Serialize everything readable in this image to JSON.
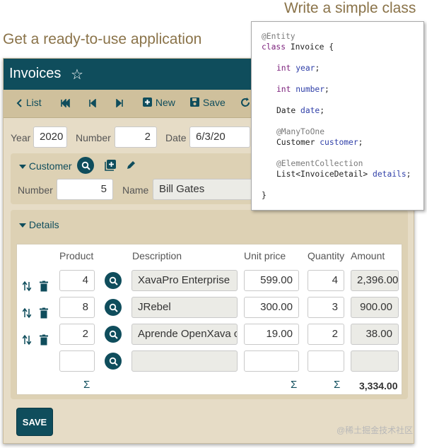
{
  "captions": {
    "left": "Get a ready-to-use application",
    "right": "Write a simple class"
  },
  "app": {
    "title": "Invoices",
    "toolbar": {
      "list": "List",
      "new": "New",
      "save": "Save"
    },
    "fields": {
      "year_label": "Year",
      "year_value": "2020",
      "number_label": "Number",
      "number_value": "2",
      "date_label": "Date",
      "date_value": "6/3/20"
    },
    "customer": {
      "section_label": "Customer",
      "number_label": "Number",
      "number_value": "5",
      "name_label": "Name",
      "name_value": "Bill Gates"
    },
    "details": {
      "section_label": "Details",
      "columns": [
        "Product",
        "Description",
        "Unit price",
        "Quantity",
        "Amount"
      ],
      "rows": [
        {
          "product": "4",
          "description": "XavaPro Enterprise",
          "unit_price": "599.00",
          "quantity": "4",
          "amount": "2,396.00"
        },
        {
          "product": "8",
          "description": "JRebel",
          "unit_price": "300.00",
          "quantity": "3",
          "amount": "900.00"
        },
        {
          "product": "2",
          "description": "Aprende OpenXava co",
          "unit_price": "19.00",
          "quantity": "2",
          "amount": "38.00"
        }
      ],
      "sigma": "Σ",
      "total": "3,334.00"
    },
    "save_button": "SAVE"
  },
  "code": {
    "lines": {
      "l1": "@Entity",
      "l2_kw": "class",
      "l2_rest": " Invoice {",
      "l3_type": "int",
      "l3_field": "year",
      "l4_type": "int",
      "l4_field": "number",
      "l5_type": "Date",
      "l5_field": "date",
      "l6": "@ManyToOne",
      "l7_type": "Customer",
      "l7_field": "customer",
      "l8": "@ElementCollection",
      "l9_type": "List<InvoiceDetail>",
      "l9_field": "details",
      "l10": "}"
    }
  },
  "watermark": "@稀土掘金技术社区",
  "colors": {
    "accent": "#0f4d5c",
    "caption": "#8a7349",
    "panel": "#e6dcc6",
    "toolbar": "#cfc09c"
  }
}
